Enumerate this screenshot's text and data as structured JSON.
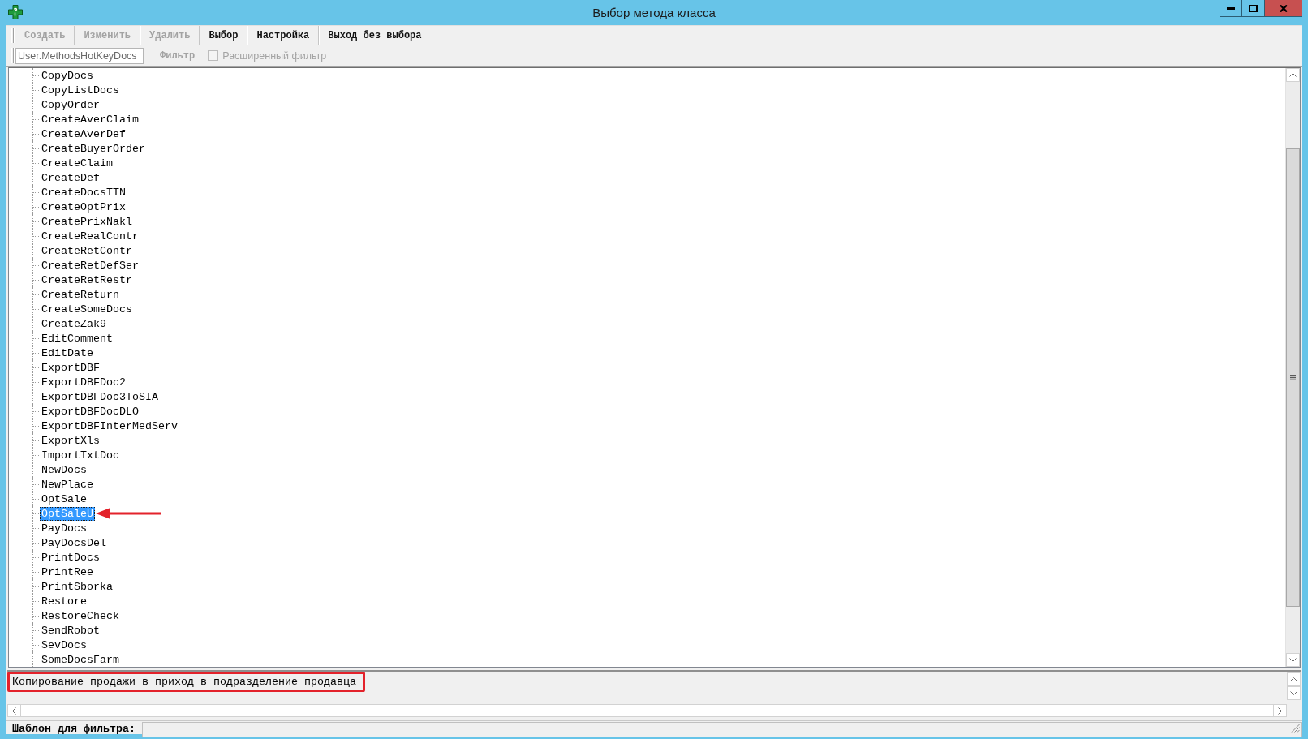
{
  "window": {
    "title": "Выбор метода класса"
  },
  "toolbar": {
    "buttons": [
      {
        "label": "Создать",
        "disabled": true
      },
      {
        "label": "Изменить",
        "disabled": true
      },
      {
        "label": "Удалить",
        "disabled": true
      },
      {
        "label": "Выбор",
        "disabled": false
      },
      {
        "label": "Настройка",
        "disabled": false
      },
      {
        "label": "Выход без выбора",
        "disabled": false
      }
    ]
  },
  "filter_bar": {
    "class_field": {
      "value": "User.MethodsHotKeyDocs"
    },
    "filter_button": {
      "label": "Фильтр",
      "disabled": true
    },
    "extended_filter": {
      "label": "Расширенный фильтр",
      "checked": false,
      "disabled": true
    }
  },
  "method_tree": {
    "items": [
      {
        "label": "CopyDocs",
        "selected": false,
        "marked": false
      },
      {
        "label": "CopyListDocs",
        "selected": false,
        "marked": false
      },
      {
        "label": "CopyOrder",
        "selected": false,
        "marked": false
      },
      {
        "label": "CreateAverClaim",
        "selected": false,
        "marked": false
      },
      {
        "label": "CreateAverDef",
        "selected": false,
        "marked": false
      },
      {
        "label": "CreateBuyerOrder",
        "selected": false,
        "marked": false
      },
      {
        "label": "CreateClaim",
        "selected": false,
        "marked": false
      },
      {
        "label": "CreateDef",
        "selected": false,
        "marked": false
      },
      {
        "label": "CreateDocsTTN",
        "selected": false,
        "marked": false
      },
      {
        "label": "CreateOptPrix",
        "selected": false,
        "marked": false
      },
      {
        "label": "CreatePrixNakl",
        "selected": false,
        "marked": false
      },
      {
        "label": "CreateRealContr",
        "selected": false,
        "marked": false
      },
      {
        "label": "CreateRetContr",
        "selected": false,
        "marked": false
      },
      {
        "label": "CreateRetDefSer",
        "selected": false,
        "marked": false
      },
      {
        "label": "CreateRetRestr",
        "selected": false,
        "marked": false
      },
      {
        "label": "CreateReturn",
        "selected": false,
        "marked": false
      },
      {
        "label": "CreateSomeDocs",
        "selected": false,
        "marked": false
      },
      {
        "label": "CreateZak9",
        "selected": false,
        "marked": false
      },
      {
        "label": "EditComment",
        "selected": false,
        "marked": false
      },
      {
        "label": "EditDate",
        "selected": false,
        "marked": false
      },
      {
        "label": "ExportDBF",
        "selected": false,
        "marked": false
      },
      {
        "label": "ExportDBFDoc2",
        "selected": false,
        "marked": false
      },
      {
        "label": "ExportDBFDoc3ToSIA",
        "selected": false,
        "marked": false
      },
      {
        "label": "ExportDBFDocDLO",
        "selected": false,
        "marked": false
      },
      {
        "label": "ExportDBFInterMedServ",
        "selected": false,
        "marked": false
      },
      {
        "label": "ExportXls",
        "selected": false,
        "marked": false
      },
      {
        "label": "ImportTxtDoc",
        "selected": false,
        "marked": false
      },
      {
        "label": "NewDocs",
        "selected": false,
        "marked": false
      },
      {
        "label": "NewPlace",
        "selected": false,
        "marked": false
      },
      {
        "label": "OptSale",
        "selected": false,
        "marked": false
      },
      {
        "label": "OptSaleU",
        "selected": true,
        "marked": true
      },
      {
        "label": "PayDocs",
        "selected": false,
        "marked": false
      },
      {
        "label": "PayDocsDel",
        "selected": false,
        "marked": false
      },
      {
        "label": "PrintDocs",
        "selected": false,
        "marked": false
      },
      {
        "label": "PrintRee",
        "selected": false,
        "marked": false
      },
      {
        "label": "PrintSborka",
        "selected": false,
        "marked": false
      },
      {
        "label": "Restore",
        "selected": false,
        "marked": false
      },
      {
        "label": "RestoreCheck",
        "selected": false,
        "marked": false
      },
      {
        "label": "SendRobot",
        "selected": false,
        "marked": false
      },
      {
        "label": "SevDocs",
        "selected": false,
        "marked": false
      },
      {
        "label": "SomeDocsFarm",
        "selected": false,
        "marked": false
      }
    ]
  },
  "description": {
    "text": "Копирование продажи в приход в подразделение продавца",
    "highlighted": true
  },
  "filter_template": {
    "label": "Шаблон для фильтра:"
  }
}
